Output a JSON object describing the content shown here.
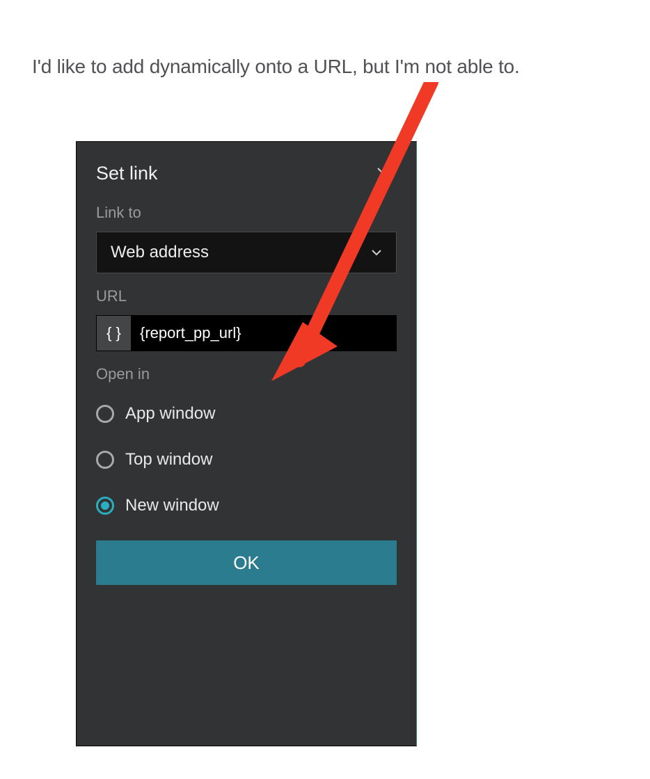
{
  "intro": "I'd like to add dynamically onto a URL, but I'm not able to.",
  "panel": {
    "title": "Set link",
    "linkto_label": "Link to",
    "linkto_value": "Web address",
    "url_label": "URL",
    "url_token_btn": "{ }",
    "url_value": "{report_pp_url}",
    "openin_label": "Open in",
    "openin_options": [
      {
        "label": "App window",
        "selected": false
      },
      {
        "label": "Top window",
        "selected": false
      },
      {
        "label": "New window",
        "selected": true
      }
    ],
    "ok": "OK"
  }
}
